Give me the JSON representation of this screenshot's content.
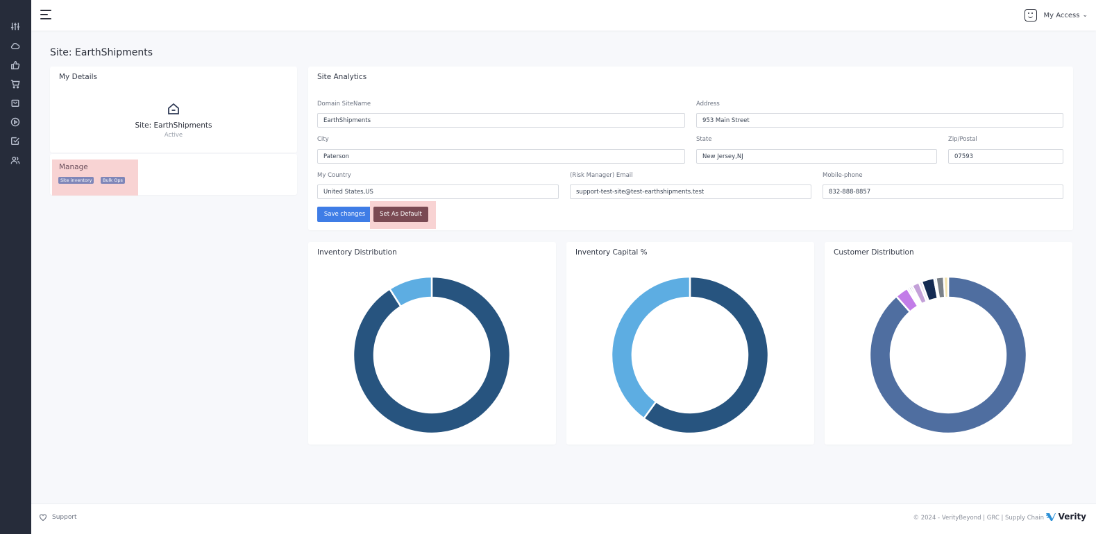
{
  "header": {
    "menu_icon": "hamburger-icon",
    "access_label": "My Access",
    "access_icon": "smiley-avatar-icon"
  },
  "sidebar": {
    "items": [
      {
        "icon": "sliders-icon"
      },
      {
        "icon": "cloud-icon"
      },
      {
        "icon": "thumbs-up-icon"
      },
      {
        "icon": "cart-icon"
      },
      {
        "icon": "shopping-bag-icon"
      },
      {
        "icon": "play-circle-icon"
      },
      {
        "icon": "checkbox-icon"
      },
      {
        "icon": "users-icon"
      }
    ]
  },
  "page": {
    "title": "Site: EarthShipments"
  },
  "details": {
    "title": "My Details",
    "site_name": "Site: EarthShipments",
    "status": "Active",
    "manage_title": "Manage",
    "badges": [
      "Site inventory",
      "Bulk Ops"
    ]
  },
  "analytics": {
    "title": "Site Analytics",
    "fields": {
      "domain": {
        "label": "Domain SiteName",
        "value": "EarthShipments"
      },
      "address": {
        "label": "Address",
        "value": "953 Main Street"
      },
      "city": {
        "label": "City",
        "value": "Paterson"
      },
      "state": {
        "label": "State",
        "value": "New Jersey,NJ"
      },
      "zip": {
        "label": "Zip/Postal",
        "value": "07593"
      },
      "country": {
        "label": "My Country",
        "value": "United States,US"
      },
      "email": {
        "label": "(Risk Manager) Email",
        "value": "support-test-site@test-earthshipments.test"
      },
      "phone": {
        "label": "Mobile-phone",
        "value": "832-888-8857"
      }
    },
    "save_label": "Save changes",
    "default_label": "Set As Default"
  },
  "chart_data": [
    {
      "type": "pie",
      "variant": "donut",
      "title": "Inventory Distribution",
      "slices": [
        {
          "value": 91,
          "color": "#27547f"
        },
        {
          "value": 9,
          "color": "#5dade2"
        }
      ]
    },
    {
      "type": "pie",
      "variant": "donut",
      "title": "Inventory Capital %",
      "slices": [
        {
          "value": 60,
          "color": "#27547f"
        },
        {
          "value": 40,
          "color": "#5dade2"
        }
      ]
    },
    {
      "type": "pie",
      "variant": "donut",
      "title": "Customer Distribution",
      "slices": [
        {
          "value": 88.5,
          "color": "#4f6ea0"
        },
        {
          "value": 2.7,
          "color": "#c27ce8"
        },
        {
          "value": 0.4,
          "color": "#9aa0d8"
        },
        {
          "value": 0.4,
          "color": "#3d3878"
        },
        {
          "value": 0.4,
          "color": "#8b6fd0"
        },
        {
          "value": 1.5,
          "color": "#c3a0d8"
        },
        {
          "value": 0.6,
          "color": "#e6dbf0"
        },
        {
          "value": 2.6,
          "color": "#132a52"
        },
        {
          "value": 0.4,
          "color": "#5c9bd8"
        },
        {
          "value": 1.6,
          "color": "#7b8188"
        },
        {
          "value": 0.9,
          "color": "#f2e2b0"
        }
      ]
    }
  ],
  "footer": {
    "support_label": "Support",
    "copyright": "© 2024 - VerityBeyond | GRC | Supply Chain",
    "brand": "Verity"
  }
}
